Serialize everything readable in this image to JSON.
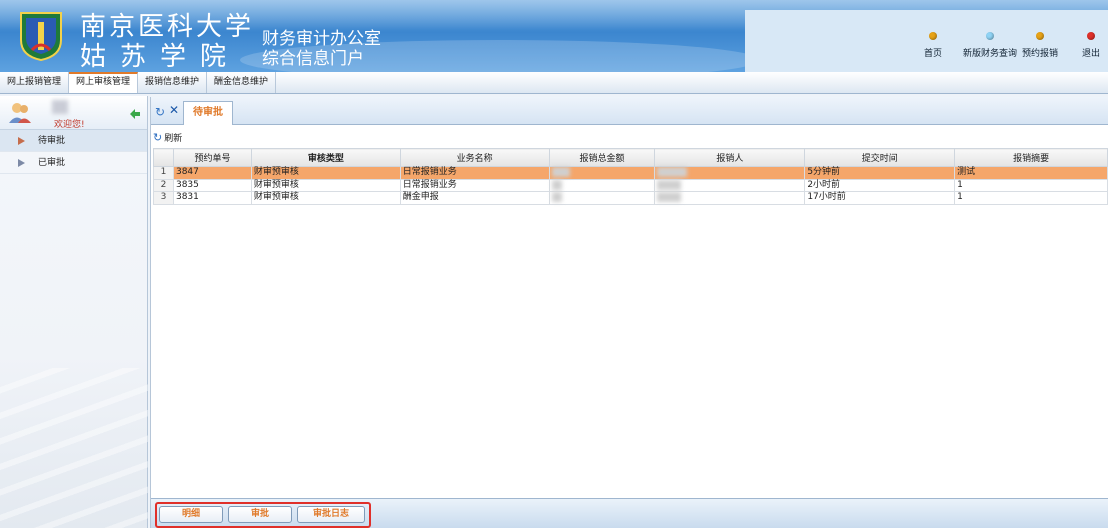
{
  "header": {
    "school_line1": "南京医科大学",
    "school_line2": "姑苏学院",
    "office_line1": "财务审计办公室",
    "office_line2": "综合信息门户",
    "nav": [
      {
        "label": "首页",
        "color": "#e8a317"
      },
      {
        "label": "新版财务查询",
        "color": "#8fd3f5"
      },
      {
        "label": "预约报销",
        "color": "#e8a317"
      },
      {
        "label": "退出",
        "color": "#e0302a"
      }
    ]
  },
  "menubar": {
    "items": [
      "网上报销管理",
      "网上审核管理",
      "报销信息维护",
      "酬金信息维护"
    ]
  },
  "sidebar": {
    "welcome": "欢迎您!",
    "items": [
      "待审批",
      "已审批"
    ]
  },
  "tab": {
    "label": "待审批"
  },
  "toolbar": {
    "refresh_label": "刷新"
  },
  "table": {
    "columns": [
      "预约单号",
      "审核类型",
      "业务名称",
      "报销总金额",
      "报销人",
      "提交时间",
      "报销摘要"
    ],
    "rows": [
      {
        "num": "1",
        "id": "3847",
        "type": "财审预审核",
        "biz": "日常报销业务",
        "time": "5分钟前",
        "summary": "测试"
      },
      {
        "num": "2",
        "id": "3835",
        "type": "财审预审核",
        "biz": "日常报销业务",
        "time": "2小时前",
        "summary": "1"
      },
      {
        "num": "3",
        "id": "3831",
        "type": "财审预审核",
        "biz": "酬金申报",
        "time": "17小时前",
        "summary": "1"
      }
    ]
  },
  "buttons": {
    "detail": "明细",
    "approve": "审批",
    "log": "审批日志"
  },
  "colors": {
    "accent": "#e07a2a",
    "selected_row": "#f5a66a",
    "highlight_frame": "#e0302a"
  }
}
